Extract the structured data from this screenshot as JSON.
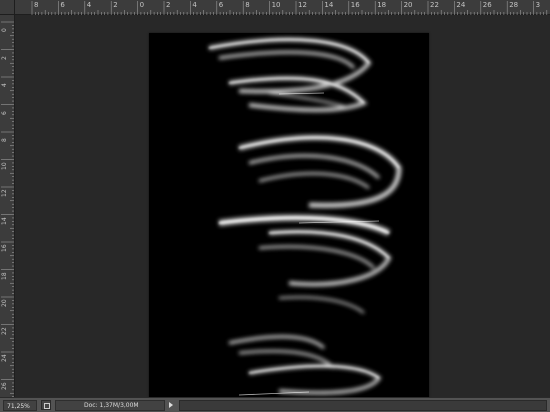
{
  "ruler_top": {
    "labels": [
      "8",
      "6",
      "4",
      "2",
      "0",
      "2",
      "4",
      "6",
      "8",
      "10",
      "12",
      "14",
      "16",
      "18",
      "20",
      "22",
      "24",
      "26",
      "28",
      "3"
    ]
  },
  "ruler_left": {
    "labels": [
      "0",
      "2",
      "4",
      "6",
      "8",
      "10",
      "12",
      "14",
      "16",
      "18",
      "20",
      "22",
      "24",
      "26"
    ]
  },
  "status": {
    "zoom": "71,25%",
    "doc_info": "Doc: 1,37M/3,00M"
  },
  "icons": {
    "proof": "proof-setup-icon",
    "arrow": "arrow-right-icon"
  },
  "colors": {
    "workspace": "#282828",
    "canvas": "#000000",
    "ruler": "#3c3c3c",
    "statusbar": "#535353"
  }
}
